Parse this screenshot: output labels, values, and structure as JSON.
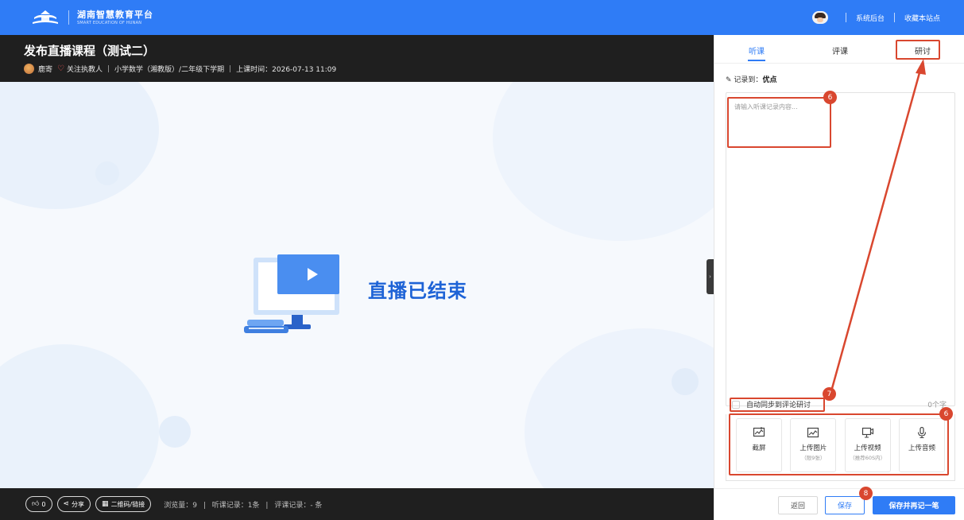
{
  "header": {
    "logo_cn": "湖南智慧教育平台",
    "logo_en": "SMART EDUCATION OF HUNAN",
    "admin_link": "系统后台",
    "bookmark_link": "收藏本站点",
    "brand_color": "#2f7cf6"
  },
  "course": {
    "title": "发布直播课程（测试二）",
    "teacher": "鹿寄",
    "follow": "关注执教人",
    "subject": "小学数学（湘教版）/二年级下学期",
    "time": "上课时间：2026-07-13 11:09"
  },
  "video": {
    "status_text": "直播已结束"
  },
  "bottom": {
    "like_count": "0",
    "share": "分享",
    "qrcode": "二维码/链接",
    "views": "浏览量：9",
    "listen_records": "听课记录：1条",
    "review_records": "评课记录：- 条"
  },
  "panel": {
    "tabs": [
      "听课",
      "评课",
      "研讨"
    ],
    "active_tab": "听课",
    "record_to_label": "记录到：",
    "record_to_value": "优点",
    "textarea_placeholder": "请输入听课记录内容...",
    "sync_label": "自动同步到评论研讨",
    "word_count": "0个字",
    "tools": [
      {
        "icon": "screenshot-icon",
        "label": "截屏",
        "sub": ""
      },
      {
        "icon": "image-upload-icon",
        "label": "上传图片",
        "sub": "（限9张）"
      },
      {
        "icon": "video-upload-icon",
        "label": "上传视频",
        "sub": "（推荐60S内）"
      },
      {
        "icon": "microphone-icon",
        "label": "上传音频",
        "sub": ""
      }
    ],
    "buttons": {
      "back": "返回",
      "save": "保存",
      "save_next": "保存并再记一笔"
    }
  },
  "annotations": {
    "color": "#d9472f",
    "badges": [
      "6",
      "7",
      "6",
      "8"
    ]
  }
}
